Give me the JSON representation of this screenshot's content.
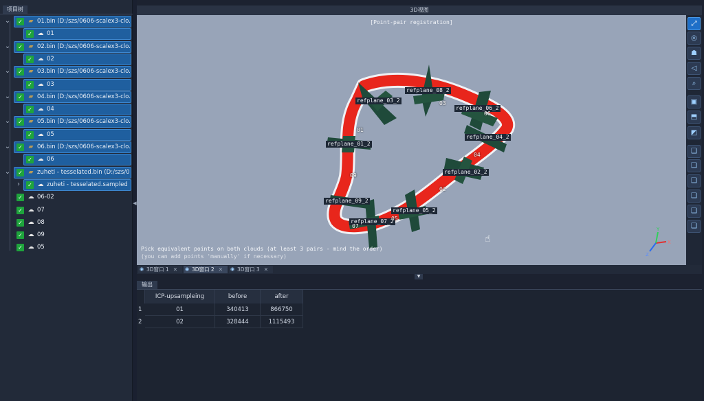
{
  "left_panel": {
    "tab_label": "项目树",
    "items": [
      {
        "label": "01.bin (D:/szs/0606-scalex3-clo...",
        "type": "file"
      },
      {
        "label": "01",
        "type": "cloud"
      },
      {
        "label": "02.bin (D:/szs/0606-scalex3-clo...",
        "type": "file"
      },
      {
        "label": "02",
        "type": "cloud"
      },
      {
        "label": "03.bin (D:/szs/0606-scalex3-clo...",
        "type": "file"
      },
      {
        "label": "03",
        "type": "cloud"
      },
      {
        "label": "04.bin (D:/szs/0606-scalex3-clo...",
        "type": "file"
      },
      {
        "label": "04",
        "type": "cloud"
      },
      {
        "label": "05.bin (D:/szs/0606-scalex3-clo...",
        "type": "file"
      },
      {
        "label": "05",
        "type": "cloud"
      },
      {
        "label": "06.bin (D:/szs/0606-scalex3-clo...",
        "type": "file"
      },
      {
        "label": "06",
        "type": "cloud"
      },
      {
        "label": "zuheti - tesselated.bin (D:/szs/0...",
        "type": "file"
      },
      {
        "label": "zuheti - tesselated.sampled",
        "type": "cloud"
      },
      {
        "label": "06-02",
        "type": "cloud"
      },
      {
        "label": "07",
        "type": "cloud"
      },
      {
        "label": "08",
        "type": "cloud"
      },
      {
        "label": "09",
        "type": "cloud"
      },
      {
        "label": "05",
        "type": "cloud"
      }
    ]
  },
  "view": {
    "header": "3D视图",
    "title": "[Point-pair registration]",
    "instruction_1": "Pick equivalent points on both clouds (at least 3 pairs - mind the order)",
    "instruction_2": "(you can add points 'manually' if necessary)",
    "refplane_labels": [
      "refplane_03_2",
      "refplane_08_2",
      "refplane_06_2",
      "refplane_01_2",
      "refplane_04_2",
      "refplane_02_2",
      "refplane_09_2",
      "refplane_05_2",
      "refplane_07_2"
    ],
    "point_labels": [
      "01",
      "04",
      "09",
      "02",
      "05",
      "07",
      "06",
      "03"
    ],
    "axes": {
      "x": "X",
      "y": "Y",
      "z": "Z"
    },
    "colors": {
      "background": "#98a4b8",
      "ring": "#e8261c",
      "plane": "#1f4a3a",
      "accent": "#1e6fc8"
    }
  },
  "toolbar": {
    "icons": [
      "fullscreen-icon",
      "pin-icon",
      "viewer-icon",
      "navigate-icon",
      "zoom-icon",
      "front-view-icon",
      "top-view-icon",
      "side-view-icon",
      "cube-view-1-icon",
      "cube-view-2-icon",
      "cube-view-3-icon",
      "cube-view-4-icon",
      "cube-view-5-icon",
      "cube-view-6-icon"
    ]
  },
  "view_tabs": [
    {
      "label": "3D窗口 1",
      "close": "✕"
    },
    {
      "label": "3D窗口 2",
      "close": "✕"
    },
    {
      "label": "3D窗口 3",
      "close": "✕"
    }
  ],
  "output": {
    "tab_label": "输出",
    "columns": [
      "ICP-upsampleing",
      "before",
      "after"
    ],
    "rows": [
      {
        "index": "1",
        "name": "01",
        "before": "340413",
        "after": "866750"
      },
      {
        "index": "2",
        "name": "02",
        "before": "328444",
        "after": "1115493"
      }
    ]
  }
}
